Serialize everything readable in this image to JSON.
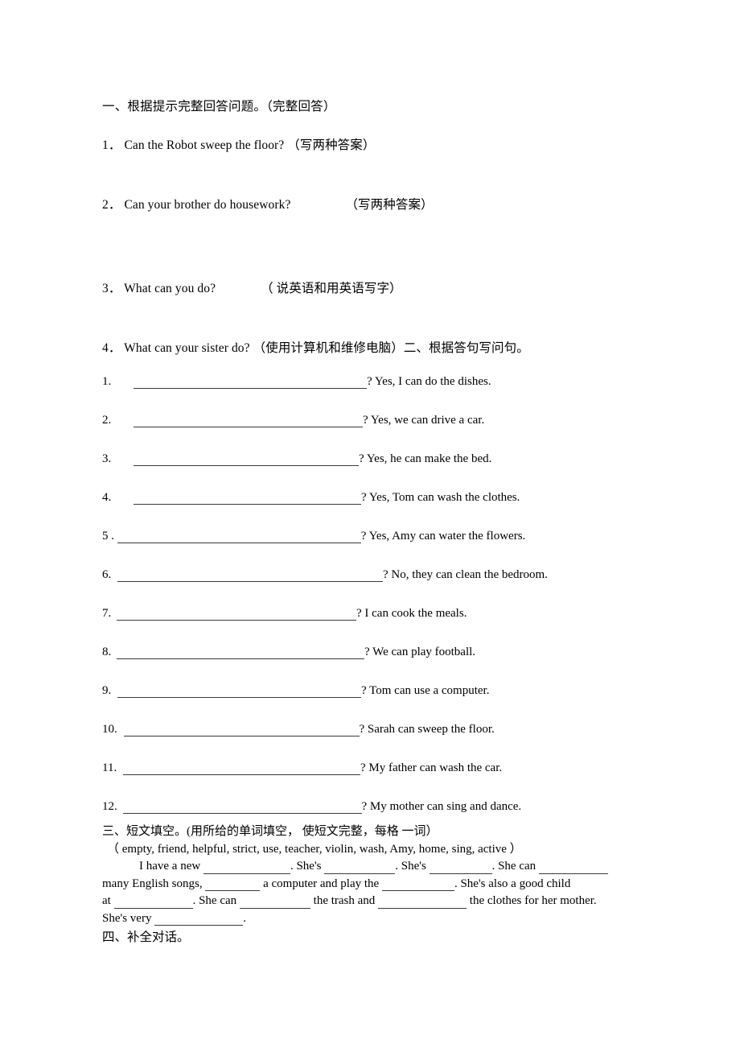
{
  "document": {
    "section_one": {
      "heading": "一、根据提示完整回答问题。（完整回答）",
      "questions": [
        {
          "num": "1．",
          "text": "Can the Robot sweep the floor?",
          "note": "（写两种答案）",
          "note_gap": 8
        },
        {
          "num": "2．",
          "text": "Can your brother do housework?",
          "note": "（写两种答案）",
          "note_gap": 60
        },
        {
          "num": "3．",
          "text": "What can you do?",
          "note": "（ 说英语和用英语写字）",
          "note_gap": 60
        },
        {
          "num": "4．",
          "text": "What can your sister do?",
          "note": "（使用计算机和维修电脑）二、根据答句写问句。",
          "note_gap": 4
        }
      ]
    },
    "section_two": {
      "heading": "二、根据答句写问句。",
      "items": [
        {
          "num": "1.",
          "indent": 24,
          "line_width": 290,
          "answer": "? Yes, I can do the dishes."
        },
        {
          "num": "2.",
          "indent": 24,
          "line_width": 285,
          "answer": "? Yes, we can drive a car."
        },
        {
          "num": "3.",
          "indent": 24,
          "line_width": 280,
          "answer": "? Yes, he can make the bed."
        },
        {
          "num": "4.",
          "indent": 24,
          "line_width": 283,
          "answer": "? Yes, Tom can wash the clothes."
        },
        {
          "num": "5 .",
          "indent": 0,
          "line_width": 303,
          "answer": "? Yes, Amy can water the flowers."
        },
        {
          "num": "6.",
          "indent": 4,
          "line_width": 330,
          "answer": "? No, they can clean the bedroom."
        },
        {
          "num": "7.",
          "indent": 3,
          "line_width": 298,
          "answer": "? I can cook the meals."
        },
        {
          "num": "8.",
          "indent": 3,
          "line_width": 308,
          "answer": "? We can play football."
        },
        {
          "num": "9.",
          "indent": 4,
          "line_width": 303,
          "answer": "? Tom can use a computer."
        },
        {
          "num": "10.",
          "indent": 4,
          "line_width": 293,
          "answer": "? Sarah can sweep the floor."
        },
        {
          "num": "11.",
          "indent": 4,
          "line_width": 295,
          "answer": "? My father can wash the car."
        },
        {
          "num": "12.",
          "indent": 3,
          "line_width": 297,
          "answer": "? My mother can sing and dance."
        }
      ]
    },
    "section_three": {
      "heading": "三、短文填空。(用所给的单词填空， 使短文完整，每格 一词）",
      "word_bank": "（ empty, friend, helpful, strict, use, teacher, violin, wash, Amy, home, sing, active ）",
      "paragraph": {
        "line1": {
          "t1": "I have a new",
          "w1": 108,
          "t2": ". She's",
          "w2": 88,
          "t3": ". She's",
          "w3": 78,
          "t4": ". She can",
          "w4": 86
        },
        "line2": {
          "t1": "many English songs,",
          "w1": 68,
          "t2": "a computer and play the",
          "w2": 90,
          "t3": ". She's also a good child"
        },
        "line3": {
          "t1": "at",
          "w1": 98,
          "t2": ". She can",
          "w2": 88,
          "t3": "the trash and",
          "w3": 110,
          "t4": "the clothes for her mother."
        },
        "line4": {
          "t1": "She's very",
          "w1": 110,
          "t2": "."
        }
      }
    },
    "section_four": {
      "heading": "四、补全对话。"
    }
  }
}
